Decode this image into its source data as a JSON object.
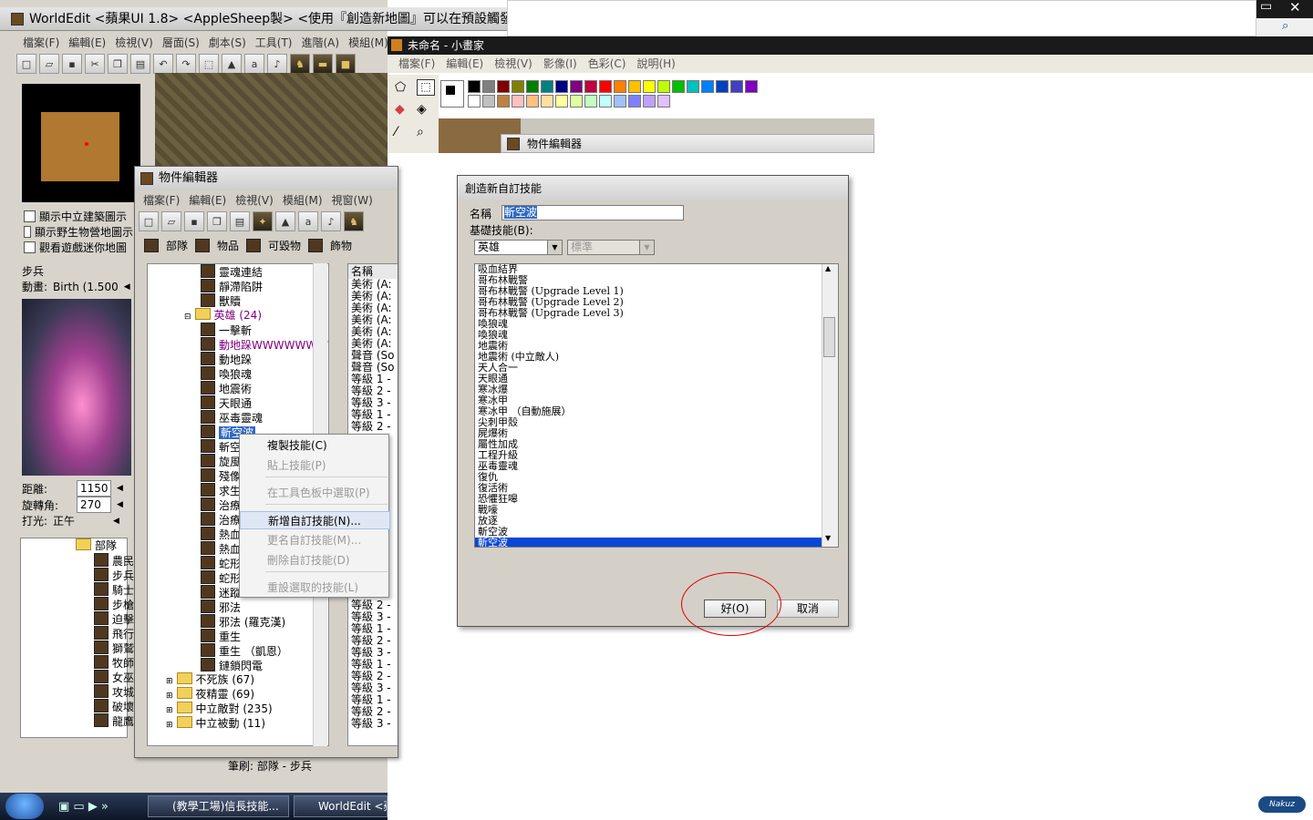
{
  "worldedit": {
    "title": "WorldEdit <蘋果UI 1.8> <AppleSheep製> <使用『創造新地圖』可以在預設觸發查看更多訊息>",
    "menu": [
      "檔案(F)",
      "編輯(E)",
      "檢視(V)",
      "層面(S)",
      "劇本(S)",
      "工具(T)",
      "進階(A)",
      "模組(M)"
    ],
    "checkboxes": [
      "顯示中立建築圖示",
      "顯示野生物營地圖示",
      "觀看遊戲迷你地圖"
    ],
    "unit_label": "步兵",
    "anim_label": "動畫:",
    "anim_value": "Birth (1.500",
    "distance_label": "距離:",
    "distance_value": "1150",
    "rotation_label": "旋轉角:",
    "rotation_value": "270",
    "lighting_label": "打光:",
    "lighting_value": "正午",
    "small_tree": {
      "folder": "部隊",
      "items": [
        "農民",
        "步兵",
        "騎士",
        "步槍",
        "迫擊",
        "飛行",
        "獅鷲",
        "牧師",
        "女巫",
        "攻城",
        "破壞",
        "龍鷹"
      ]
    },
    "status_text": "筆刷: 部隊 - 步兵"
  },
  "object_editor": {
    "title": "物件編輯器",
    "menu": [
      "檔案(F)",
      "編輯(E)",
      "檢視(V)",
      "模組(M)",
      "視窗(W)"
    ],
    "tabs": [
      "部隊",
      "物品",
      "可毀物",
      "飾物"
    ],
    "tree_items": [
      {
        "label": "靈魂連結",
        "color": "#000000"
      },
      {
        "label": "靜滯陷阱",
        "color": "#000000"
      },
      {
        "label": "獸贖",
        "color": "#000000"
      },
      {
        "label": "英雄 (24)",
        "color": "#800080",
        "folder": true
      },
      {
        "label": "一擊斬",
        "color": "#000000"
      },
      {
        "label": "動地跺WWWWWWWWW",
        "color": "#800080"
      },
      {
        "label": "動地跺",
        "color": "#000000"
      },
      {
        "label": "喚狼魂",
        "color": "#000000"
      },
      {
        "label": "地震術",
        "color": "#000000"
      },
      {
        "label": "天眼通",
        "color": "#000000"
      },
      {
        "label": "巫毒靈魂",
        "color": "#000000"
      },
      {
        "label": "斬空波",
        "color": "#ffffff",
        "selected": true
      },
      {
        "label": "斬空波",
        "color": "#000000"
      },
      {
        "label": "旋風斬",
        "color": "#000000"
      },
      {
        "label": "殘像",
        "color": "#000000"
      },
      {
        "label": "求生",
        "color": "#000000"
      },
      {
        "label": "治療",
        "color": "#000000"
      },
      {
        "label": "治療",
        "color": "#000000"
      },
      {
        "label": "熱血",
        "color": "#000000"
      },
      {
        "label": "熱血",
        "color": "#000000"
      },
      {
        "label": "蛇形",
        "color": "#000000"
      },
      {
        "label": "蛇形",
        "color": "#000000"
      },
      {
        "label": "迷蹤",
        "color": "#000000"
      },
      {
        "label": "邪法",
        "color": "#000000"
      },
      {
        "label": "邪法 (羅克漢)",
        "color": "#000000"
      },
      {
        "label": "重生",
        "color": "#000000"
      },
      {
        "label": "重生 （凱恩）",
        "color": "#000000"
      },
      {
        "label": "鏈鎖閃電",
        "color": "#000000"
      },
      {
        "label": "不死族 (67)",
        "color": "#000000",
        "folder": true
      },
      {
        "label": "夜精靈 (69)",
        "color": "#000000",
        "folder": true
      },
      {
        "label": "中立敵對 (235)",
        "color": "#000000",
        "folder": true
      },
      {
        "label": "中立被動 (11)",
        "color": "#000000",
        "folder": true
      }
    ],
    "names_header": "名稱",
    "names_col": [
      "美術 (A:",
      "美術 (A:",
      "美術 (A:",
      "美術 (A:",
      "美術 (A:",
      "美術 (A:",
      "聲音 (So",
      "聲音 (So",
      "等級 1 -",
      "等級 2 -",
      "等級 3 -",
      "等級 1 -",
      "等級 2 -"
    ],
    "names_col_bottom": [
      "等級 2 -",
      "等級 3 -",
      "等級 1 -",
      "等級 2 -",
      "等級 3 -",
      "等級 1 -",
      "等級 2 -",
      "等級 3 -",
      "等級 1 -",
      "等級 2 -",
      "等級 3 -"
    ]
  },
  "context_menu": {
    "items": [
      {
        "label": "複製技能(C)",
        "enabled": true
      },
      {
        "label": "貼上技能(P)",
        "enabled": false
      },
      {
        "label": "在工具色板中選取(P)",
        "enabled": false
      },
      {
        "label": "新增自訂技能(N)...",
        "enabled": true,
        "highlighted": true
      },
      {
        "label": "更名自訂技能(M)...",
        "enabled": false
      },
      {
        "label": "刪除自訂技能(D)",
        "enabled": false
      },
      {
        "label": "重設選取的技能(L)",
        "enabled": false
      }
    ]
  },
  "paint": {
    "title": "未命名 - 小畫家",
    "menu": [
      "檔案(F)",
      "編輯(E)",
      "檢視(V)",
      "影像(I)",
      "色彩(C)",
      "說明(H)"
    ],
    "palette_top": [
      "#000000",
      "#808080",
      "#800000",
      "#808000",
      "#008000",
      "#008080",
      "#000080",
      "#800080",
      "#c00040",
      "#ff0000",
      "#ff8000",
      "#ffc000",
      "#ffff00",
      "#c0ff00",
      "#00c000",
      "#00c0c0",
      "#0080ff",
      "#0040c0",
      "#4040c0",
      "#8000c0"
    ],
    "palette_bottom": [
      "#ffffff",
      "#c0c0c0",
      "#c08040",
      "#ffc0c0",
      "#ffc080",
      "#ffe0a0",
      "#ffffa0",
      "#e0ffa0",
      "#c0ffc0",
      "#c0ffff",
      "#a0c0ff",
      "#8080ff",
      "#c0a0ff",
      "#e0c0ff"
    ],
    "inner_object_editor_title": "物件編輯器"
  },
  "dialog": {
    "title": "創造新自訂技能",
    "name_label": "名稱",
    "name_value": "斬空波",
    "base_label": "基礎技能(B):",
    "base_value": "英雄",
    "base_value2": "標準",
    "list_items": [
      "吸血結界",
      "哥布林戰警",
      "哥布林戰警 (Upgrade Level 1)",
      "哥布林戰警 (Upgrade Level 2)",
      "哥布林戰警 (Upgrade Level 3)",
      "喚狼魂",
      "喚狼魂",
      "地震術",
      "地震術 (中立敵人)",
      "天人合一",
      "天眼通",
      "寒冰爆",
      "寒冰甲",
      "寒冰甲 （自動施展）",
      "尖刺甲殼",
      "屍爆術",
      "屬性加成",
      "工程升級",
      "巫毒靈魂",
      "復仇",
      "復活術",
      "恐懼狂嗥",
      "戰嚎",
      "放逐",
      "斬空波",
      "斬空波"
    ],
    "ok_label": "好(O)",
    "cancel_label": "取消"
  },
  "taskbar": {
    "tasks": [
      "(教學工場)信長技能...",
      "WorldEdit <蘋"
    ]
  },
  "watermark": "Nakuz"
}
